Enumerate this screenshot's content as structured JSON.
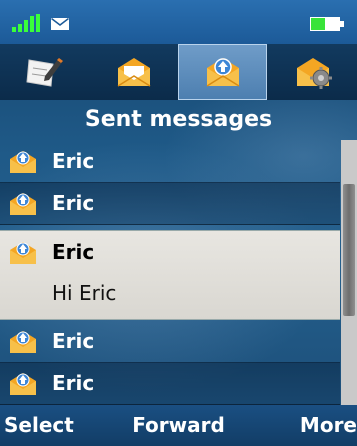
{
  "status": {
    "signal_icon": "signal-bars-icon",
    "message_icon": "envelope-icon",
    "battery_icon": "battery-icon"
  },
  "tabs": [
    {
      "icon": "compose-message-icon",
      "active": false
    },
    {
      "icon": "inbox-icon",
      "active": false
    },
    {
      "icon": "sent-messages-icon",
      "active": true
    },
    {
      "icon": "message-settings-icon",
      "active": false
    }
  ],
  "title": "Sent messages",
  "messages": [
    {
      "name": "Eric"
    },
    {
      "name": "Eric"
    },
    {
      "name": "Eric",
      "preview": "Hi Eric",
      "selected": true
    },
    {
      "name": "Eric"
    },
    {
      "name": "Eric"
    }
  ],
  "softkeys": {
    "left": "Select",
    "middle": "Forward",
    "right": "More"
  },
  "colors": {
    "accent": "#2a6fb0",
    "selected_row": "#e2e0db",
    "tab_active": "#5c8cbc"
  }
}
